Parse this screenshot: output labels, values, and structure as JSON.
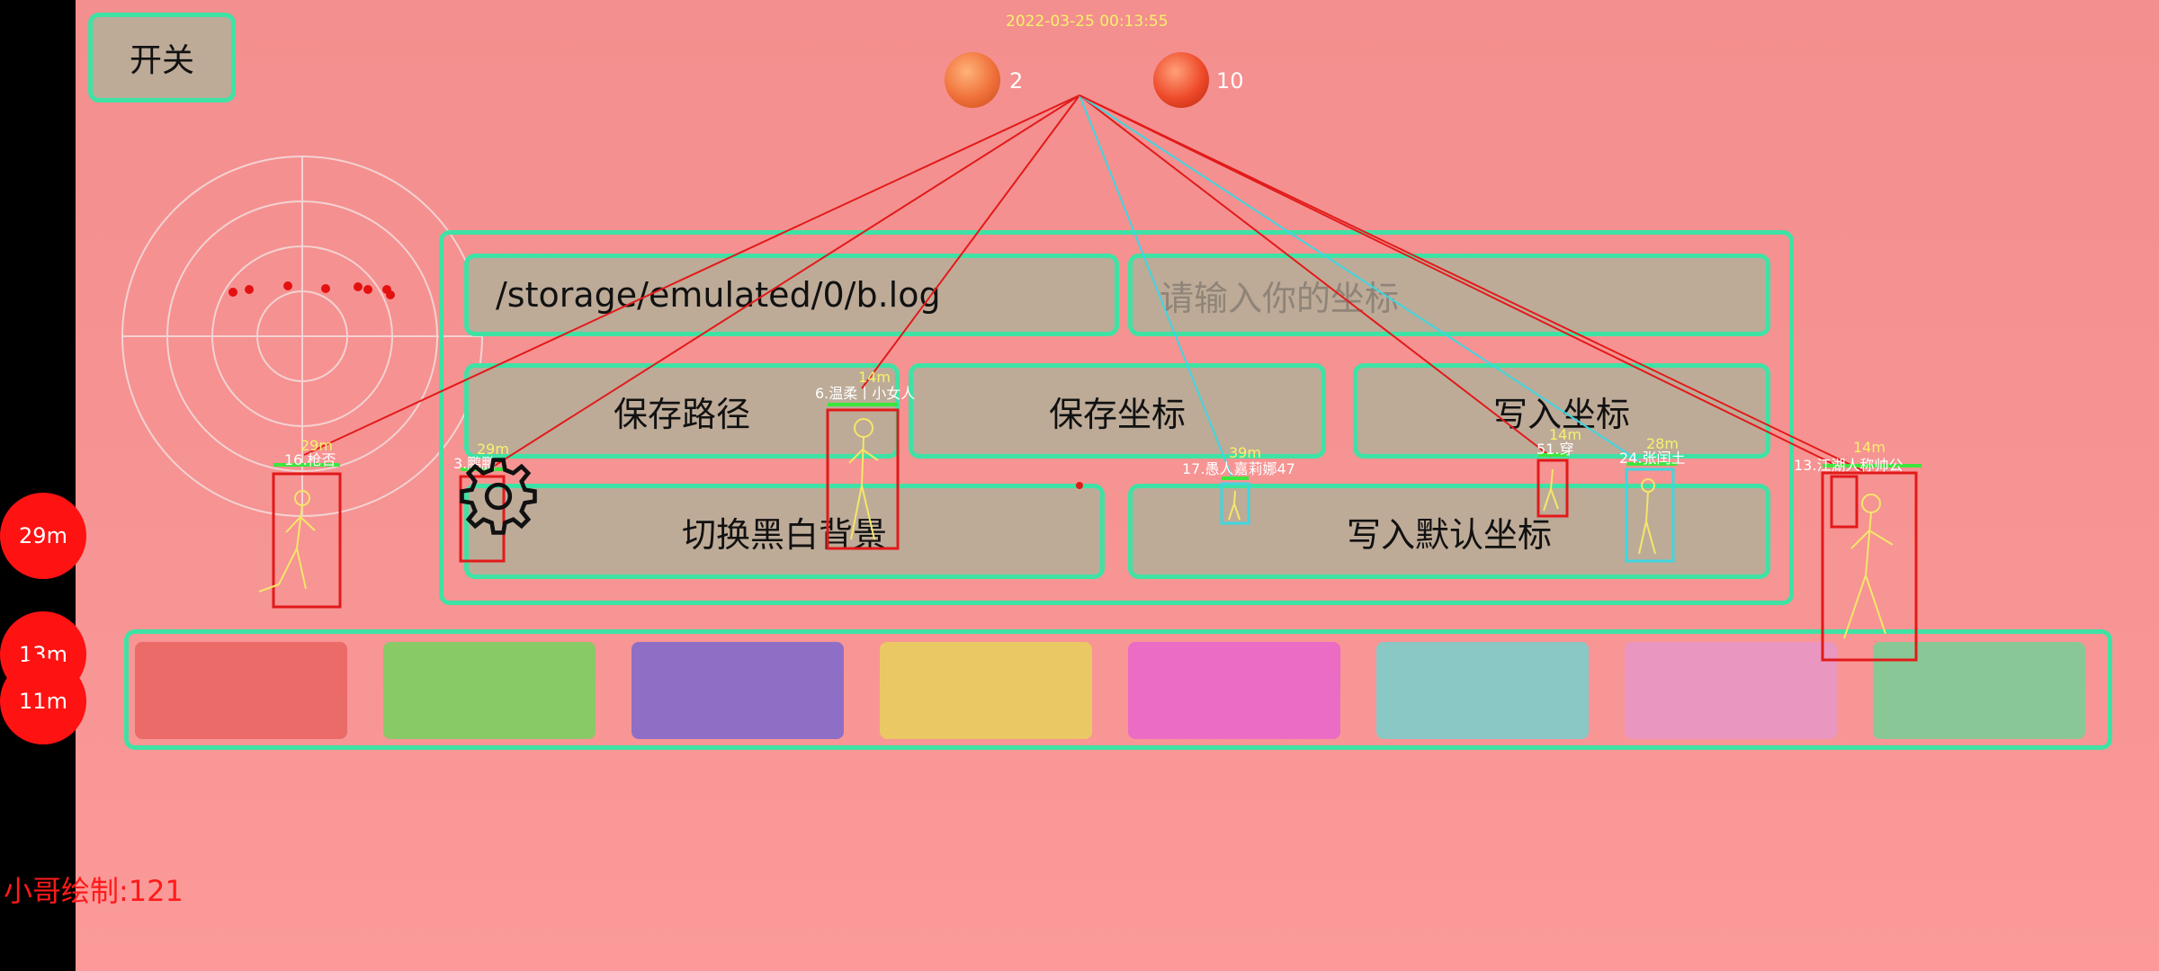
{
  "header": {
    "timestamp": "2022-03-25 00:13:55",
    "calm_count": "2",
    "angry_count": "10"
  },
  "controls": {
    "toggle_label": "开关",
    "path_value": "/storage/emulated/0/b.log",
    "coord_placeholder": "请输入你的坐标",
    "save_path_label": "保存路径",
    "save_coord_label": "保存坐标",
    "write_coord_label": "写入坐标",
    "toggle_bw_label": "切换黑白背景",
    "write_default_label": "写入默认坐标"
  },
  "palette": {
    "colors": [
      "#ea6b67",
      "#88ca66",
      "#8f6ec6",
      "#eac964",
      "#ea6cc4",
      "#89c8c4",
      "#e996c1",
      "#89c896"
    ]
  },
  "distance_markers": [
    "29m",
    "13m",
    "11m"
  ],
  "players": [
    {
      "label": "16.枪否",
      "distance": "29m",
      "box_color": "red"
    },
    {
      "label": "3.鹏鹏",
      "distance": "29m",
      "box_color": "red"
    },
    {
      "label": "6.温柔丨小女人",
      "distance": "14m",
      "box_color": "red"
    },
    {
      "label": "17.愚人嘉莉娜47",
      "distance": "39m",
      "box_color": "cyan"
    },
    {
      "label": "51.穿",
      "distance": "14m",
      "box_color": "red"
    },
    {
      "label": "24.张闰土",
      "distance": "28m",
      "box_color": "cyan"
    },
    {
      "label": "13.江湖人称帅公",
      "distance": "14m",
      "box_color": "red"
    }
  ],
  "footer": {
    "credit": "小哥绘制:121"
  },
  "colors": {
    "accent_border": "#3ee2a4",
    "button_fill": "#bdab98",
    "enemy_red": "#e21a1a",
    "enemy_cyan": "#3fd6e0",
    "label_yellow": "#f8f16a"
  }
}
